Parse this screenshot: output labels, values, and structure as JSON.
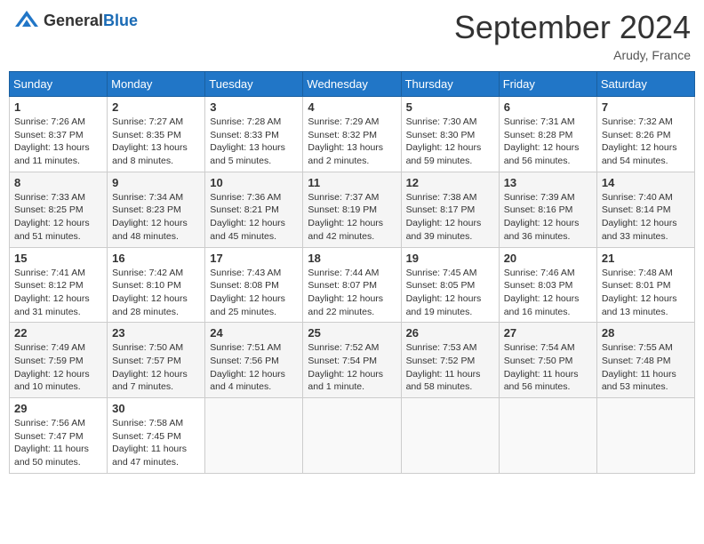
{
  "header": {
    "logo_general": "General",
    "logo_blue": "Blue",
    "title": "September 2024",
    "location": "Arudy, France"
  },
  "weekdays": [
    "Sunday",
    "Monday",
    "Tuesday",
    "Wednesday",
    "Thursday",
    "Friday",
    "Saturday"
  ],
  "weeks": [
    [
      {
        "day": "1",
        "sunrise": "7:26 AM",
        "sunset": "8:37 PM",
        "daylight": "13 hours and 11 minutes."
      },
      {
        "day": "2",
        "sunrise": "7:27 AM",
        "sunset": "8:35 PM",
        "daylight": "13 hours and 8 minutes."
      },
      {
        "day": "3",
        "sunrise": "7:28 AM",
        "sunset": "8:33 PM",
        "daylight": "13 hours and 5 minutes."
      },
      {
        "day": "4",
        "sunrise": "7:29 AM",
        "sunset": "8:32 PM",
        "daylight": "13 hours and 2 minutes."
      },
      {
        "day": "5",
        "sunrise": "7:30 AM",
        "sunset": "8:30 PM",
        "daylight": "12 hours and 59 minutes."
      },
      {
        "day": "6",
        "sunrise": "7:31 AM",
        "sunset": "8:28 PM",
        "daylight": "12 hours and 56 minutes."
      },
      {
        "day": "7",
        "sunrise": "7:32 AM",
        "sunset": "8:26 PM",
        "daylight": "12 hours and 54 minutes."
      }
    ],
    [
      {
        "day": "8",
        "sunrise": "7:33 AM",
        "sunset": "8:25 PM",
        "daylight": "12 hours and 51 minutes."
      },
      {
        "day": "9",
        "sunrise": "7:34 AM",
        "sunset": "8:23 PM",
        "daylight": "12 hours and 48 minutes."
      },
      {
        "day": "10",
        "sunrise": "7:36 AM",
        "sunset": "8:21 PM",
        "daylight": "12 hours and 45 minutes."
      },
      {
        "day": "11",
        "sunrise": "7:37 AM",
        "sunset": "8:19 PM",
        "daylight": "12 hours and 42 minutes."
      },
      {
        "day": "12",
        "sunrise": "7:38 AM",
        "sunset": "8:17 PM",
        "daylight": "12 hours and 39 minutes."
      },
      {
        "day": "13",
        "sunrise": "7:39 AM",
        "sunset": "8:16 PM",
        "daylight": "12 hours and 36 minutes."
      },
      {
        "day": "14",
        "sunrise": "7:40 AM",
        "sunset": "8:14 PM",
        "daylight": "12 hours and 33 minutes."
      }
    ],
    [
      {
        "day": "15",
        "sunrise": "7:41 AM",
        "sunset": "8:12 PM",
        "daylight": "12 hours and 31 minutes."
      },
      {
        "day": "16",
        "sunrise": "7:42 AM",
        "sunset": "8:10 PM",
        "daylight": "12 hours and 28 minutes."
      },
      {
        "day": "17",
        "sunrise": "7:43 AM",
        "sunset": "8:08 PM",
        "daylight": "12 hours and 25 minutes."
      },
      {
        "day": "18",
        "sunrise": "7:44 AM",
        "sunset": "8:07 PM",
        "daylight": "12 hours and 22 minutes."
      },
      {
        "day": "19",
        "sunrise": "7:45 AM",
        "sunset": "8:05 PM",
        "daylight": "12 hours and 19 minutes."
      },
      {
        "day": "20",
        "sunrise": "7:46 AM",
        "sunset": "8:03 PM",
        "daylight": "12 hours and 16 minutes."
      },
      {
        "day": "21",
        "sunrise": "7:48 AM",
        "sunset": "8:01 PM",
        "daylight": "12 hours and 13 minutes."
      }
    ],
    [
      {
        "day": "22",
        "sunrise": "7:49 AM",
        "sunset": "7:59 PM",
        "daylight": "12 hours and 10 minutes."
      },
      {
        "day": "23",
        "sunrise": "7:50 AM",
        "sunset": "7:57 PM",
        "daylight": "12 hours and 7 minutes."
      },
      {
        "day": "24",
        "sunrise": "7:51 AM",
        "sunset": "7:56 PM",
        "daylight": "12 hours and 4 minutes."
      },
      {
        "day": "25",
        "sunrise": "7:52 AM",
        "sunset": "7:54 PM",
        "daylight": "12 hours and 1 minute."
      },
      {
        "day": "26",
        "sunrise": "7:53 AM",
        "sunset": "7:52 PM",
        "daylight": "11 hours and 58 minutes."
      },
      {
        "day": "27",
        "sunrise": "7:54 AM",
        "sunset": "7:50 PM",
        "daylight": "11 hours and 56 minutes."
      },
      {
        "day": "28",
        "sunrise": "7:55 AM",
        "sunset": "7:48 PM",
        "daylight": "11 hours and 53 minutes."
      }
    ],
    [
      {
        "day": "29",
        "sunrise": "7:56 AM",
        "sunset": "7:47 PM",
        "daylight": "11 hours and 50 minutes."
      },
      {
        "day": "30",
        "sunrise": "7:58 AM",
        "sunset": "7:45 PM",
        "daylight": "11 hours and 47 minutes."
      },
      null,
      null,
      null,
      null,
      null
    ]
  ],
  "labels": {
    "sunrise": "Sunrise:",
    "sunset": "Sunset:",
    "daylight": "Daylight:"
  }
}
